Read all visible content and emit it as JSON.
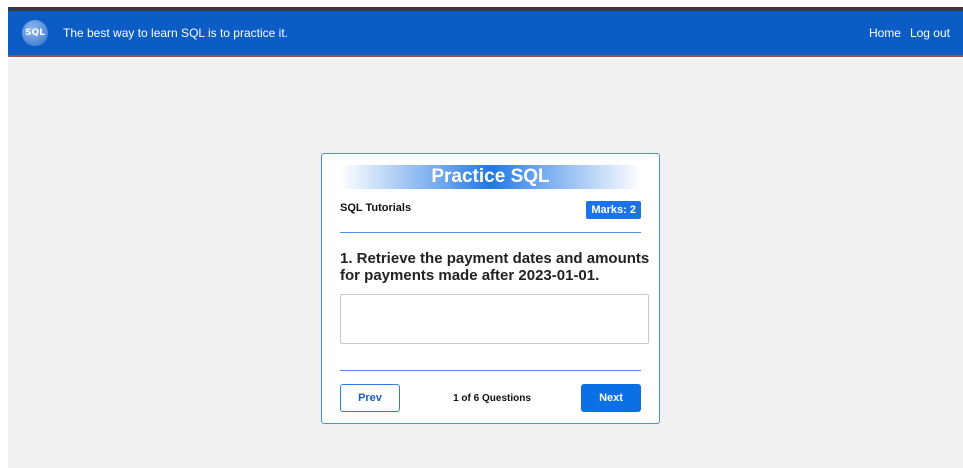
{
  "navbar": {
    "logo_text": "SQL",
    "tagline": "The best way to learn SQL is to practice it.",
    "links": [
      {
        "label": "Home"
      },
      {
        "label": "Log out"
      }
    ],
    "bg_color": "#0b5cc4"
  },
  "card": {
    "title": "Practice SQL",
    "subtitle": "SQL Tutorials",
    "marks_label": "Marks: 2",
    "question": "1. Retrieve the payment dates and amounts for payments made after 2023-01-01.",
    "answer": {
      "value": "",
      "placeholder": ""
    },
    "prev_label": "Prev",
    "counter": "1 of 6 Questions",
    "next_label": "Next",
    "accent_color": "#1a73e8"
  }
}
